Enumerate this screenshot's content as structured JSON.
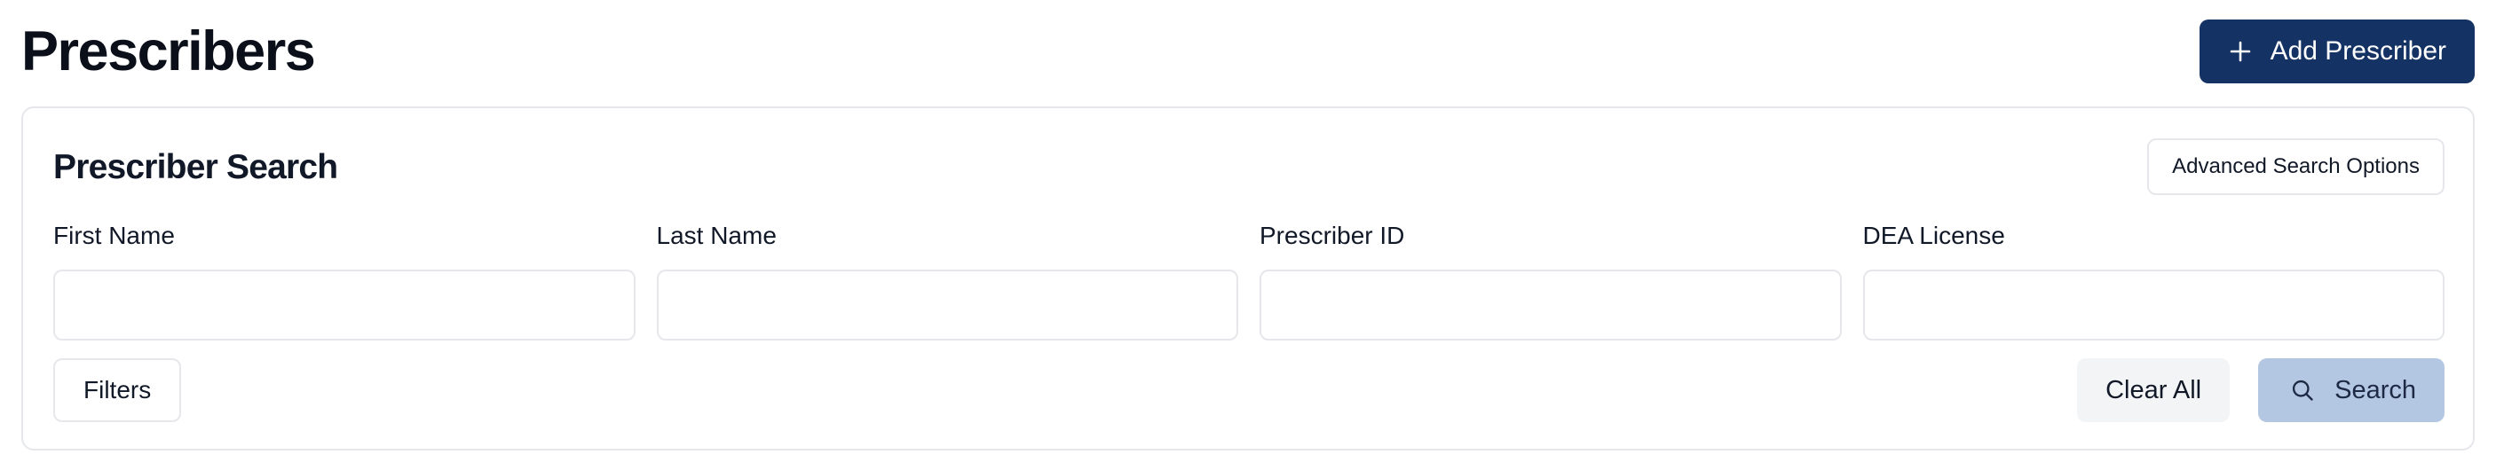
{
  "header": {
    "title": "Prescribers",
    "add_button_label": "Add Prescriber",
    "add_button_icon": "plus-icon"
  },
  "search_card": {
    "title": "Prescriber Search",
    "advanced_button_label": "Advanced Search Options",
    "fields": [
      {
        "label": "First Name",
        "value": "",
        "placeholder": ""
      },
      {
        "label": "Last Name",
        "value": "",
        "placeholder": ""
      },
      {
        "label": "Prescriber ID",
        "value": "",
        "placeholder": ""
      },
      {
        "label": "DEA License",
        "value": "",
        "placeholder": ""
      }
    ],
    "filters_button_label": "Filters",
    "clear_button_label": "Clear All",
    "search_button_label": "Search",
    "search_button_icon": "search-icon"
  },
  "colors": {
    "primary": "#143263",
    "search_button_bg": "#b3c6e2",
    "clear_button_bg": "#f3f4f6",
    "border": "#e5e7eb"
  }
}
